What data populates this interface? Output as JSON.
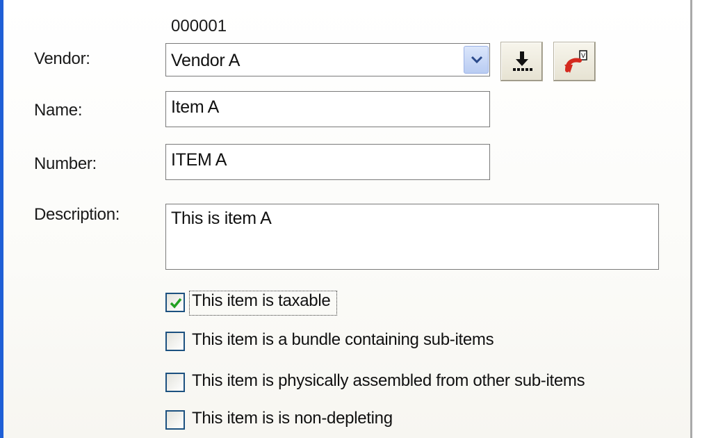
{
  "record": {
    "id": "000001"
  },
  "form": {
    "vendor_label": "Vendor:",
    "vendor_value": "Vendor A",
    "name_label": "Name:",
    "name_value": "Item A",
    "number_label": "Number:",
    "number_value": "ITEM A",
    "description_label": "Description:",
    "description_value": "This is item A"
  },
  "toolbar": {
    "import_icon": "download-icon",
    "undo_icon": "undo-arrow-icon"
  },
  "checkboxes": [
    {
      "label": "This item is taxable",
      "checked": true,
      "focused": true
    },
    {
      "label": "This item is a bundle containing sub-items",
      "checked": false
    },
    {
      "label": "This item is physically assembled from other sub-items",
      "checked": false
    },
    {
      "label": "This item is is non-depleting",
      "checked": false
    }
  ],
  "colors": {
    "window_frame": "#1f5fd6",
    "checkbox_border": "#1c5180",
    "check_mark": "#21a121",
    "dropdown_button": "#b9ccf2",
    "undo_arrow": "#d42a1f"
  }
}
